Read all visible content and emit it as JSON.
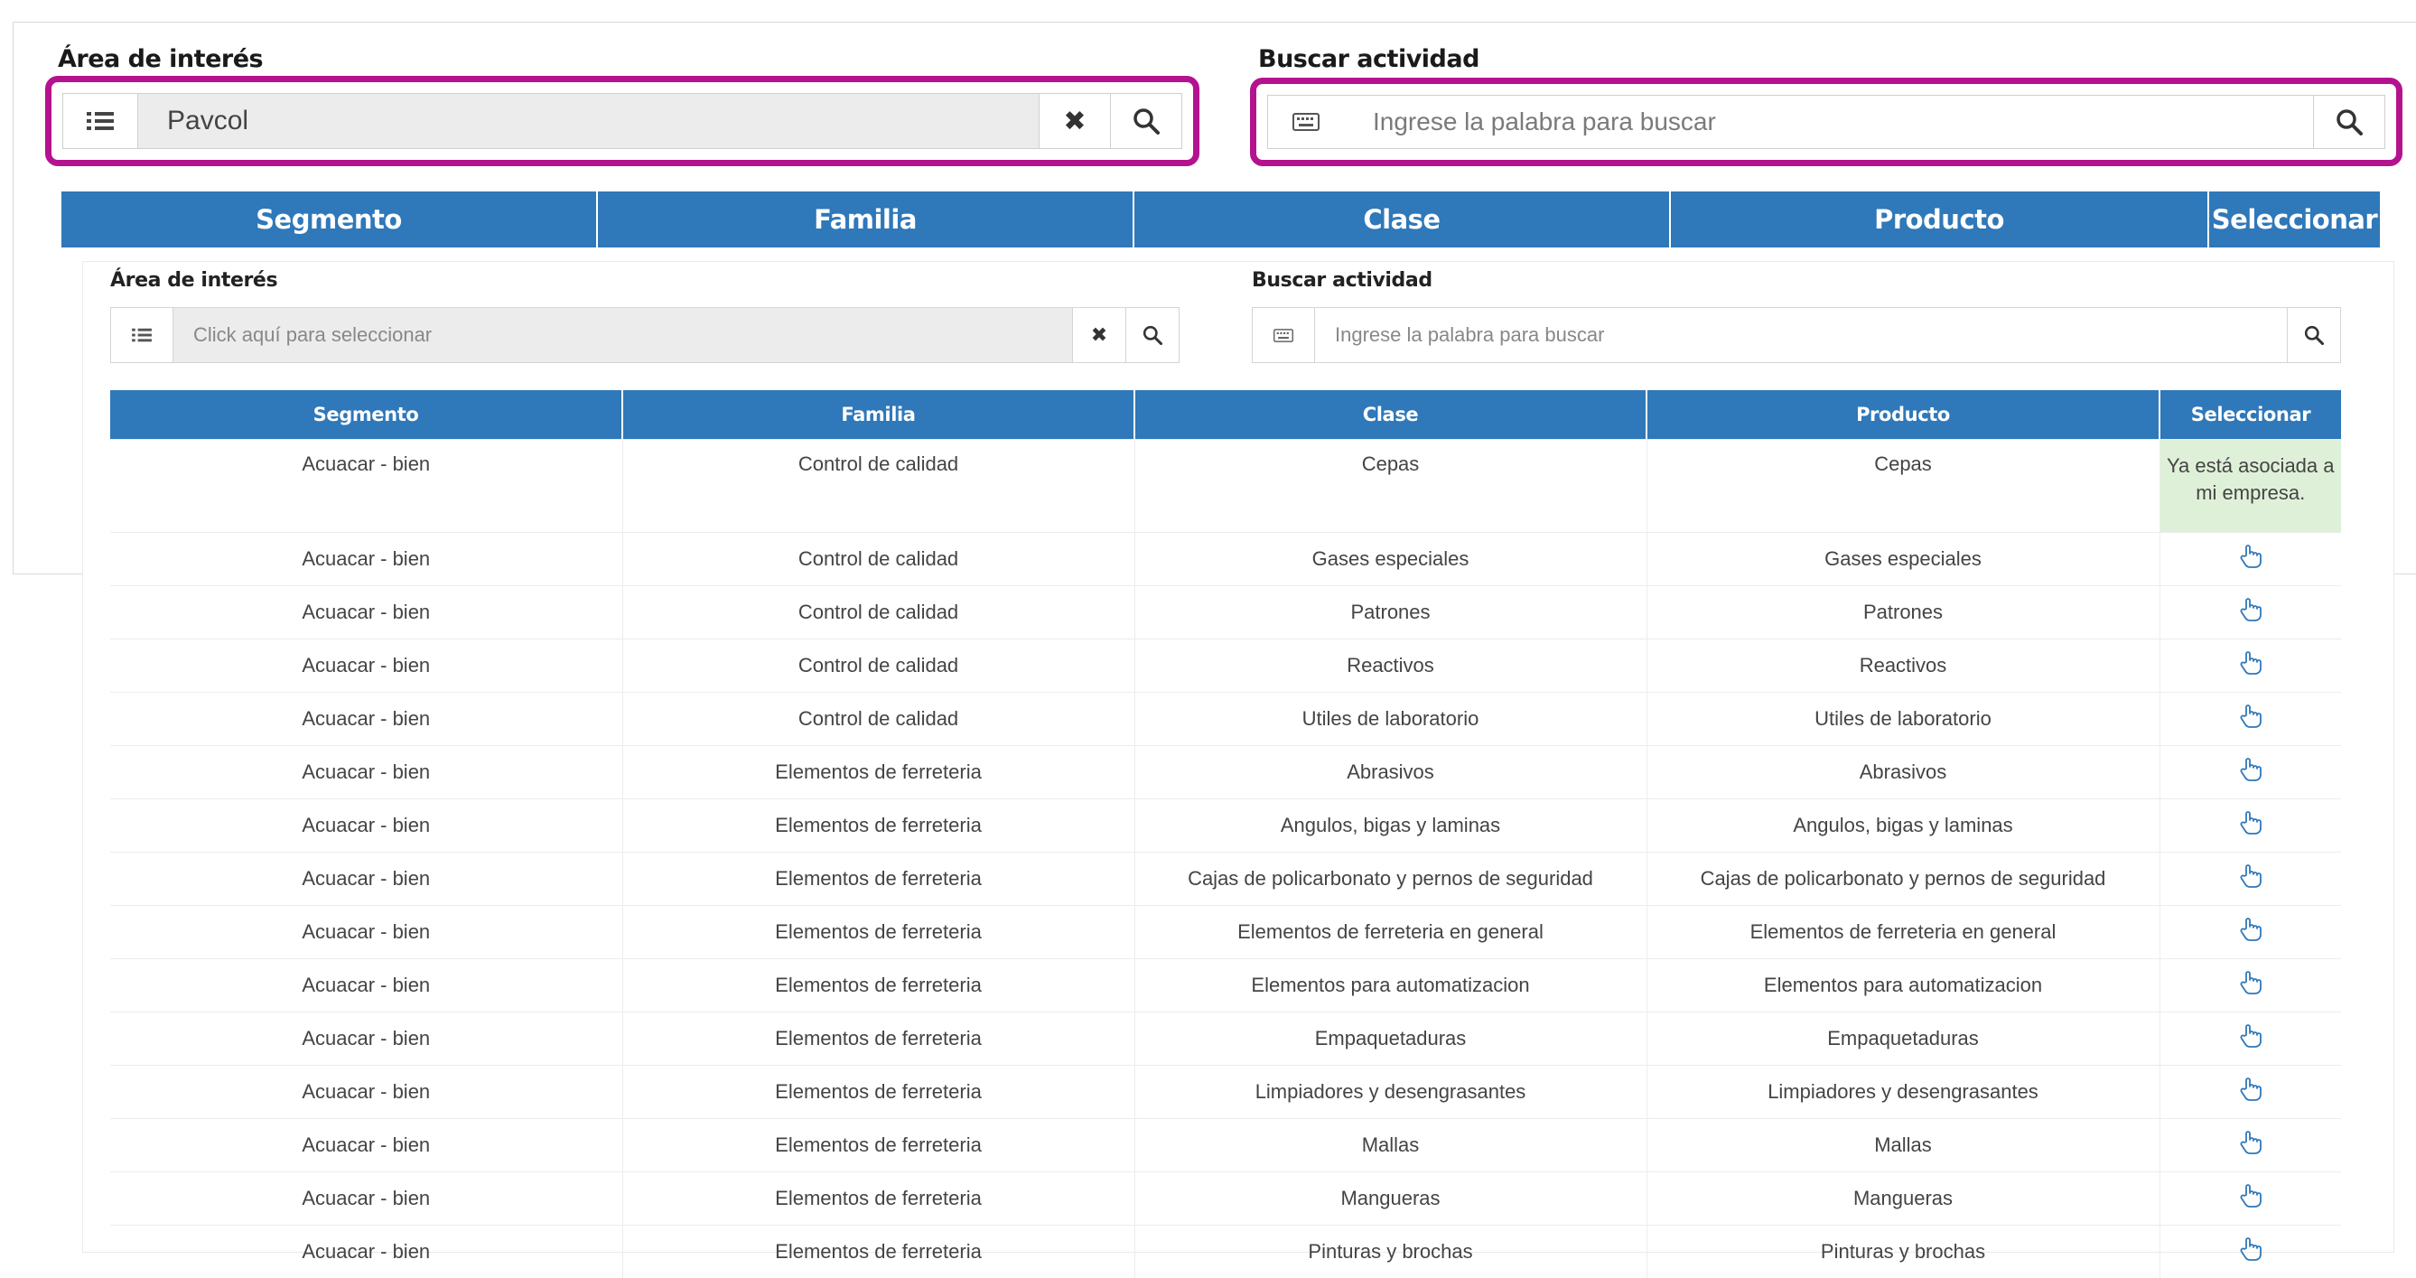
{
  "large": {
    "area_label": "Área de interés",
    "area_value": "Pavcol",
    "search_label": "Buscar actividad",
    "search_placeholder": "Ingrese la palabra para buscar",
    "columns": [
      "Segmento",
      "Familia",
      "Clase",
      "Producto",
      "Seleccionar"
    ]
  },
  "small": {
    "area_label": "Área de interés",
    "area_placeholder": "Click aquí para seleccionar",
    "search_label": "Buscar actividad",
    "search_placeholder": "Ingrese la palabra para buscar",
    "columns": [
      "Segmento",
      "Familia",
      "Clase",
      "Producto",
      "Seleccionar"
    ]
  },
  "icons": {
    "list": "list-icon",
    "clear": "close-icon",
    "search": "search-icon",
    "keyboard": "keyboard-icon",
    "select": "hand-pointer-icon"
  },
  "colors": {
    "header_blue": "#2f78b9",
    "highlight_magenta": "#b5128f",
    "associated_green_bg": "#dff0d8"
  },
  "associated_text": "Ya está asociada a mi empresa.",
  "rows": [
    {
      "segmento": "Acuacar - bien",
      "familia": "Control de calidad",
      "clase": "Cepas",
      "producto": "Cepas",
      "associated": true
    },
    {
      "segmento": "Acuacar - bien",
      "familia": "Control de calidad",
      "clase": "Gases especiales",
      "producto": "Gases especiales",
      "associated": false
    },
    {
      "segmento": "Acuacar - bien",
      "familia": "Control de calidad",
      "clase": "Patrones",
      "producto": "Patrones",
      "associated": false
    },
    {
      "segmento": "Acuacar - bien",
      "familia": "Control de calidad",
      "clase": "Reactivos",
      "producto": "Reactivos",
      "associated": false
    },
    {
      "segmento": "Acuacar - bien",
      "familia": "Control de calidad",
      "clase": "Utiles de laboratorio",
      "producto": "Utiles de laboratorio",
      "associated": false
    },
    {
      "segmento": "Acuacar - bien",
      "familia": "Elementos de ferreteria",
      "clase": "Abrasivos",
      "producto": "Abrasivos",
      "associated": false
    },
    {
      "segmento": "Acuacar - bien",
      "familia": "Elementos de ferreteria",
      "clase": "Angulos, bigas y laminas",
      "producto": "Angulos, bigas y laminas",
      "associated": false
    },
    {
      "segmento": "Acuacar - bien",
      "familia": "Elementos de ferreteria",
      "clase": "Cajas de policarbonato y pernos de seguridad",
      "producto": "Cajas de policarbonato y pernos de seguridad",
      "associated": false
    },
    {
      "segmento": "Acuacar - bien",
      "familia": "Elementos de ferreteria",
      "clase": "Elementos de ferreteria en general",
      "producto": "Elementos de ferreteria en general",
      "associated": false
    },
    {
      "segmento": "Acuacar - bien",
      "familia": "Elementos de ferreteria",
      "clase": "Elementos para automatizacion",
      "producto": "Elementos para automatizacion",
      "associated": false
    },
    {
      "segmento": "Acuacar - bien",
      "familia": "Elementos de ferreteria",
      "clase": "Empaquetaduras",
      "producto": "Empaquetaduras",
      "associated": false
    },
    {
      "segmento": "Acuacar - bien",
      "familia": "Elementos de ferreteria",
      "clase": "Limpiadores y desengrasantes",
      "producto": "Limpiadores y desengrasantes",
      "associated": false
    },
    {
      "segmento": "Acuacar - bien",
      "familia": "Elementos de ferreteria",
      "clase": "Mallas",
      "producto": "Mallas",
      "associated": false
    },
    {
      "segmento": "Acuacar - bien",
      "familia": "Elementos de ferreteria",
      "clase": "Mangueras",
      "producto": "Mangueras",
      "associated": false
    },
    {
      "segmento": "Acuacar - bien",
      "familia": "Elementos de ferreteria",
      "clase": "Pinturas y brochas",
      "producto": "Pinturas y brochas",
      "associated": false
    }
  ]
}
